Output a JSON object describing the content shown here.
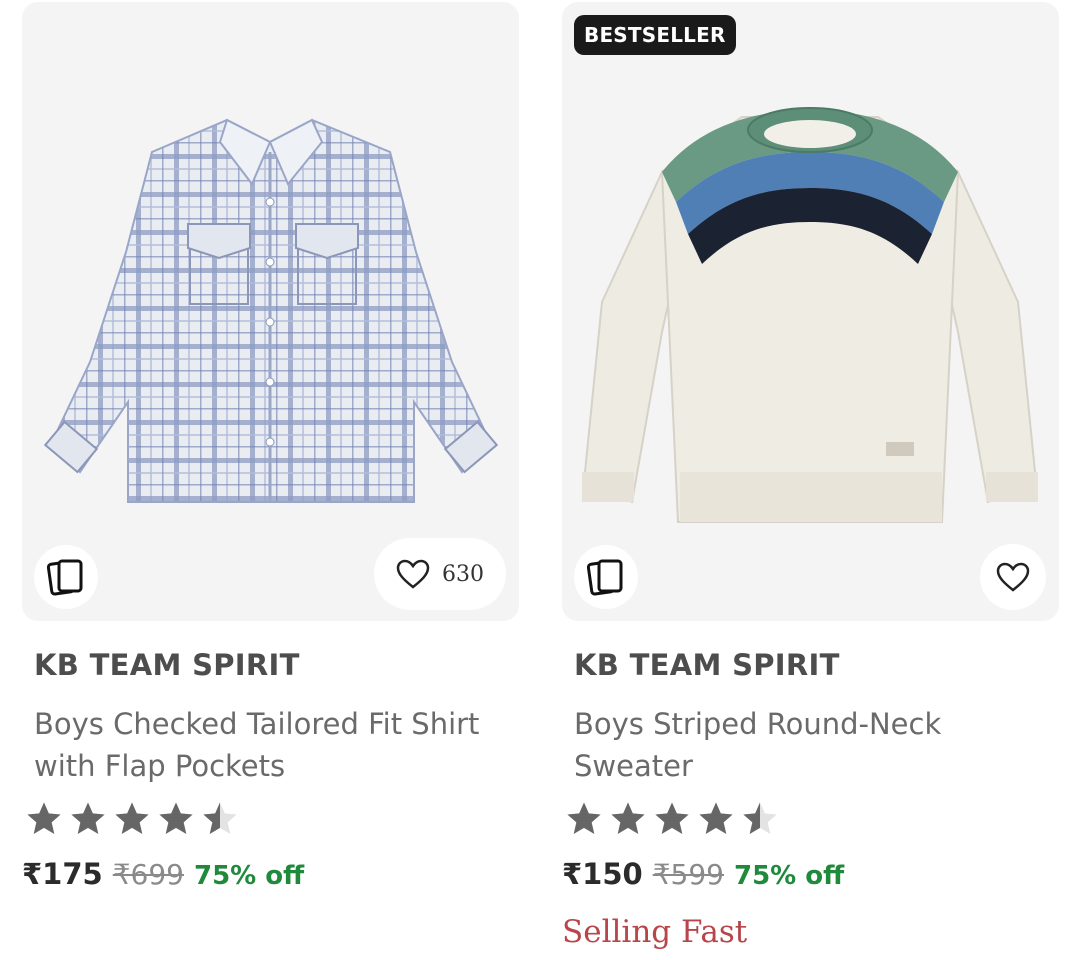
{
  "products": [
    {
      "badge": "",
      "brand": "KB TEAM SPIRIT",
      "title": "Boys Checked Tailored Fit Shirt with Flap Pockets",
      "rating": 4.5,
      "price": "₹175",
      "mrp": "₹699",
      "discount": "75% off",
      "wishlist_count": "630",
      "tag": "",
      "image_icon": "checked-shirt-image"
    },
    {
      "badge": "BESTSELLER",
      "brand": "KB TEAM SPIRIT",
      "title": "Boys Striped Round-Neck Sweater",
      "rating": 4.5,
      "price": "₹150",
      "mrp": "₹599",
      "discount": "75% off",
      "wishlist_count": "",
      "tag": "Selling Fast",
      "image_icon": "striped-sweater-image"
    }
  ],
  "colors": {
    "star_filled": "#666666",
    "star_empty": "#e3e3e3",
    "discount": "#1f8a3c",
    "tag": "#b7454a",
    "badge_bg": "#1a1a1a"
  }
}
